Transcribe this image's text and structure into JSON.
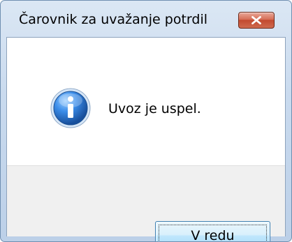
{
  "window": {
    "title": "Čarovnik za uvažanje potrdil"
  },
  "title_bar": {
    "close_icon": "close-icon"
  },
  "message": {
    "icon": "info-icon",
    "text": "Uvoz je uspel."
  },
  "buttons": {
    "ok_label": "V redu"
  },
  "colors": {
    "close_button": "#c8553c",
    "info_icon": "#1f5fb3",
    "ok_button_border": "#3c7fb1",
    "button_area": "#f0f0f0"
  }
}
